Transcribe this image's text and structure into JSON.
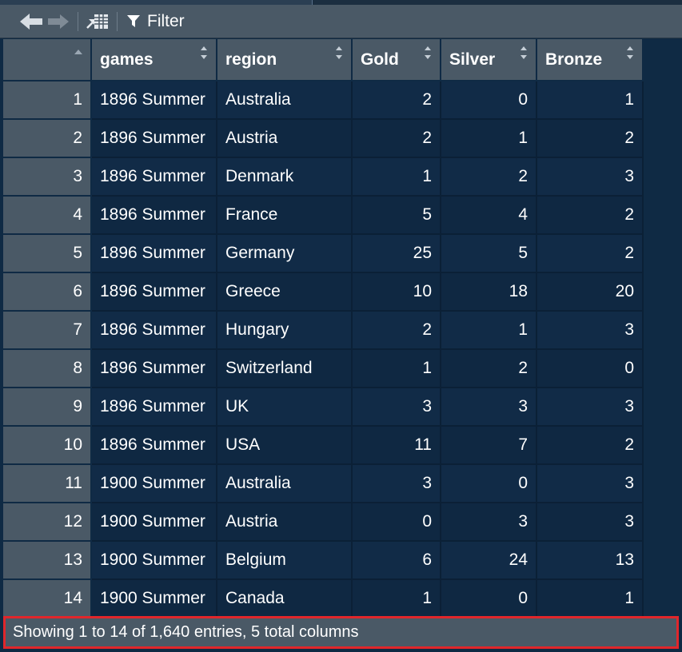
{
  "toolbar": {
    "back_icon": "arrow-left-icon",
    "forward_icon": "arrow-right-icon",
    "popout_icon": "popout-icon",
    "filter_icon": "filter-funnel-icon",
    "filter_label": "Filter"
  },
  "table": {
    "columns": [
      "games",
      "region",
      "Gold",
      "Silver",
      "Bronze"
    ],
    "rows": [
      {
        "idx": "1",
        "games": "1896 Summer",
        "region": "Australia",
        "gold": "2",
        "silver": "0",
        "bronze": "1"
      },
      {
        "idx": "2",
        "games": "1896 Summer",
        "region": "Austria",
        "gold": "2",
        "silver": "1",
        "bronze": "2"
      },
      {
        "idx": "3",
        "games": "1896 Summer",
        "region": "Denmark",
        "gold": "1",
        "silver": "2",
        "bronze": "3"
      },
      {
        "idx": "4",
        "games": "1896 Summer",
        "region": "France",
        "gold": "5",
        "silver": "4",
        "bronze": "2"
      },
      {
        "idx": "5",
        "games": "1896 Summer",
        "region": "Germany",
        "gold": "25",
        "silver": "5",
        "bronze": "2"
      },
      {
        "idx": "6",
        "games": "1896 Summer",
        "region": "Greece",
        "gold": "10",
        "silver": "18",
        "bronze": "20"
      },
      {
        "idx": "7",
        "games": "1896 Summer",
        "region": "Hungary",
        "gold": "2",
        "silver": "1",
        "bronze": "3"
      },
      {
        "idx": "8",
        "games": "1896 Summer",
        "region": "Switzerland",
        "gold": "1",
        "silver": "2",
        "bronze": "0"
      },
      {
        "idx": "9",
        "games": "1896 Summer",
        "region": "UK",
        "gold": "3",
        "silver": "3",
        "bronze": "3"
      },
      {
        "idx": "10",
        "games": "1896 Summer",
        "region": "USA",
        "gold": "11",
        "silver": "7",
        "bronze": "2"
      },
      {
        "idx": "11",
        "games": "1900 Summer",
        "region": "Australia",
        "gold": "3",
        "silver": "0",
        "bronze": "3"
      },
      {
        "idx": "12",
        "games": "1900 Summer",
        "region": "Austria",
        "gold": "0",
        "silver": "3",
        "bronze": "3"
      },
      {
        "idx": "13",
        "games": "1900 Summer",
        "region": "Belgium",
        "gold": "6",
        "silver": "24",
        "bronze": "13"
      },
      {
        "idx": "14",
        "games": "1900 Summer",
        "region": "Canada",
        "gold": "1",
        "silver": "0",
        "bronze": "1"
      }
    ]
  },
  "status": {
    "text": "Showing 1 to 14 of 1,640 entries, 5 total columns",
    "highlight_color": "#e1262b"
  },
  "colors": {
    "background": "#0f2a44",
    "header": "#4a5966"
  }
}
